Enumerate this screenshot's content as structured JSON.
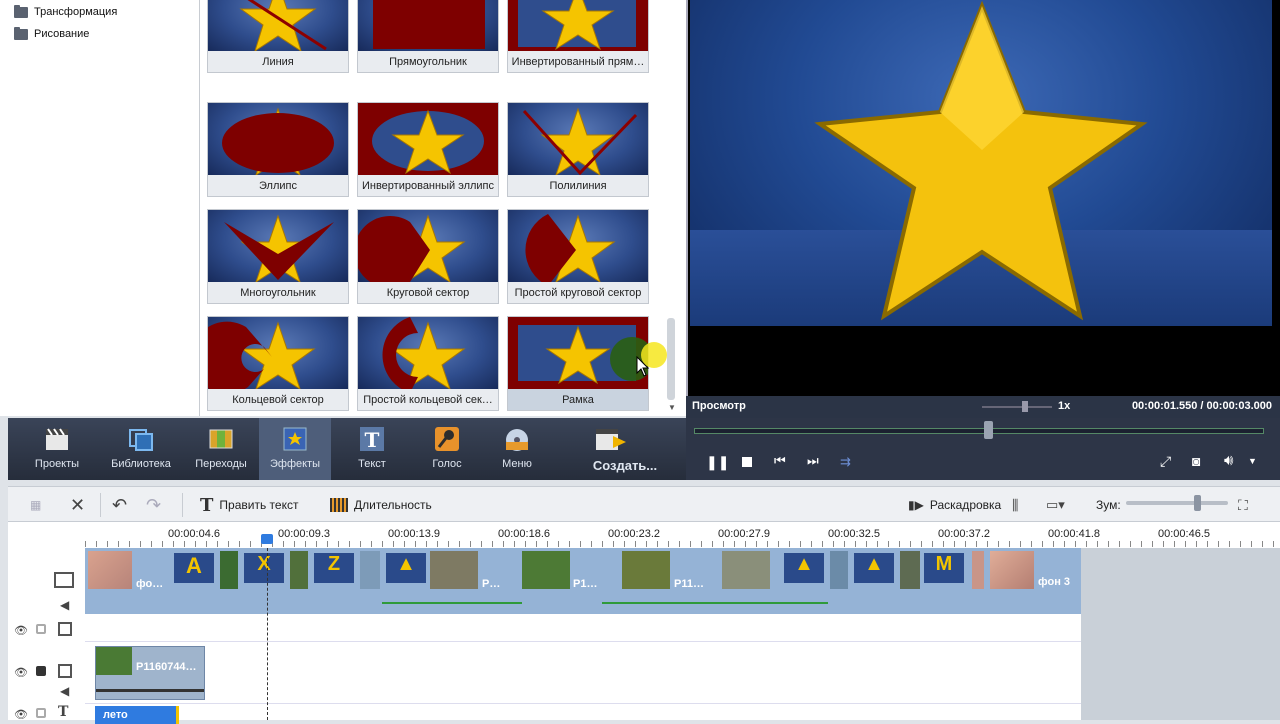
{
  "tree": {
    "items": [
      "Трансформация",
      "Рисование"
    ]
  },
  "effects": {
    "tiles": [
      {
        "label": "Линия"
      },
      {
        "label": "Прямоугольник"
      },
      {
        "label": "Инвертированный прям…"
      },
      {
        "label": "Эллипс"
      },
      {
        "label": "Инвертированный эллипс"
      },
      {
        "label": "Полилиния"
      },
      {
        "label": "Многоугольник"
      },
      {
        "label": "Круговой сектор"
      },
      {
        "label": "Простой круговой сектор"
      },
      {
        "label": "Кольцевой сектор"
      },
      {
        "label": "Простой кольцевой сек…"
      },
      {
        "label": "Рамка"
      }
    ]
  },
  "preview": {
    "title": "Просмотр",
    "speed": "1x",
    "time": "00:00:01.550 / 00:00:03.000"
  },
  "toolbar": {
    "items": [
      "Проекты",
      "Библиотека",
      "Переходы",
      "Эффекты",
      "Текст",
      "Голос",
      "Меню",
      "Создать..."
    ]
  },
  "editbar": {
    "edit_text": "Править текст",
    "duration": "Длительность",
    "storyboard": "Раскадровка",
    "zoom": "Зум:"
  },
  "ruler": {
    "ticks": [
      "00:00:04.6",
      "00:00:09.3",
      "00:00:13.9",
      "00:00:18.6",
      "00:00:23.2",
      "00:00:27.9",
      "00:00:32.5",
      "00:00:37.2",
      "00:00:41.8",
      "00:00:46.5"
    ]
  },
  "timeline": {
    "clip_labels": [
      "фо…",
      "Р…",
      "P1…",
      "P11…",
      "фон 3"
    ],
    "overlay_clip": "P1160744…",
    "text_clip": "лето"
  },
  "colors": {
    "accent": "#2f7be0",
    "toolbar_bg": "#2d3547",
    "track_blue": "#95b3d6"
  }
}
